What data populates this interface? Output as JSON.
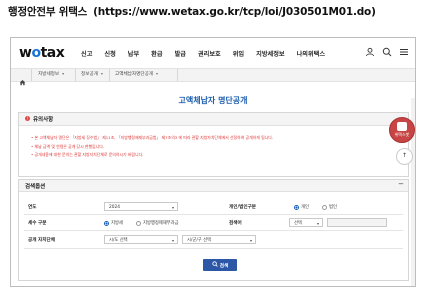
{
  "caption": {
    "title": "행정안전부 위택스",
    "url": "(https://www.wetax.go.kr/tcp/loi/J030501M01.do)"
  },
  "header": {
    "logo": "wetax",
    "nav": [
      "신고",
      "신청",
      "납부",
      "환급",
      "발급",
      "권리보호",
      "위임",
      "지방세정보",
      "나의위택스"
    ],
    "icons": [
      "user-icon",
      "search-icon",
      "menu-icon"
    ]
  },
  "breadcrumb": {
    "items": [
      "지방세정보",
      "정보공개",
      "고액체납자명단공개"
    ]
  },
  "page_title": "고액체납자 명단공개",
  "notice": {
    "title": "유의사항",
    "lines": [
      "• 본 고액체납자 명단은 「지방세 징수법」 제11조, 「지방행정제재부과금법」 제7조의3 에 따라 관할 지방자치단체에서 선정하여 공개하게 됩니다.",
      "• 체납 금액 및 연령은 공개 당시 현행입니다.",
      "• 공개내용에 대한 문의는 관할 지방자치단체로 문의하시기 바랍니다."
    ]
  },
  "search": {
    "title": "검색옵션",
    "year_label": "연도",
    "year_value": "2024",
    "type_label": "개인/법인구분",
    "type_options": [
      "개인",
      "법인"
    ],
    "type_selected": "개인",
    "tax_label": "세수 구분",
    "tax_options": [
      "지방세",
      "지방행정제재부과금"
    ],
    "tax_selected": "지방세",
    "keyword_label": "검색어",
    "keyword_select": "선택",
    "region_label": "공개 자치단체",
    "region_sido": "시/도 선택",
    "region_sigungu": "시/군/구 선택",
    "search_button": "검색"
  },
  "floating": {
    "badge_label": "위택스봇",
    "top_label": "↑"
  }
}
